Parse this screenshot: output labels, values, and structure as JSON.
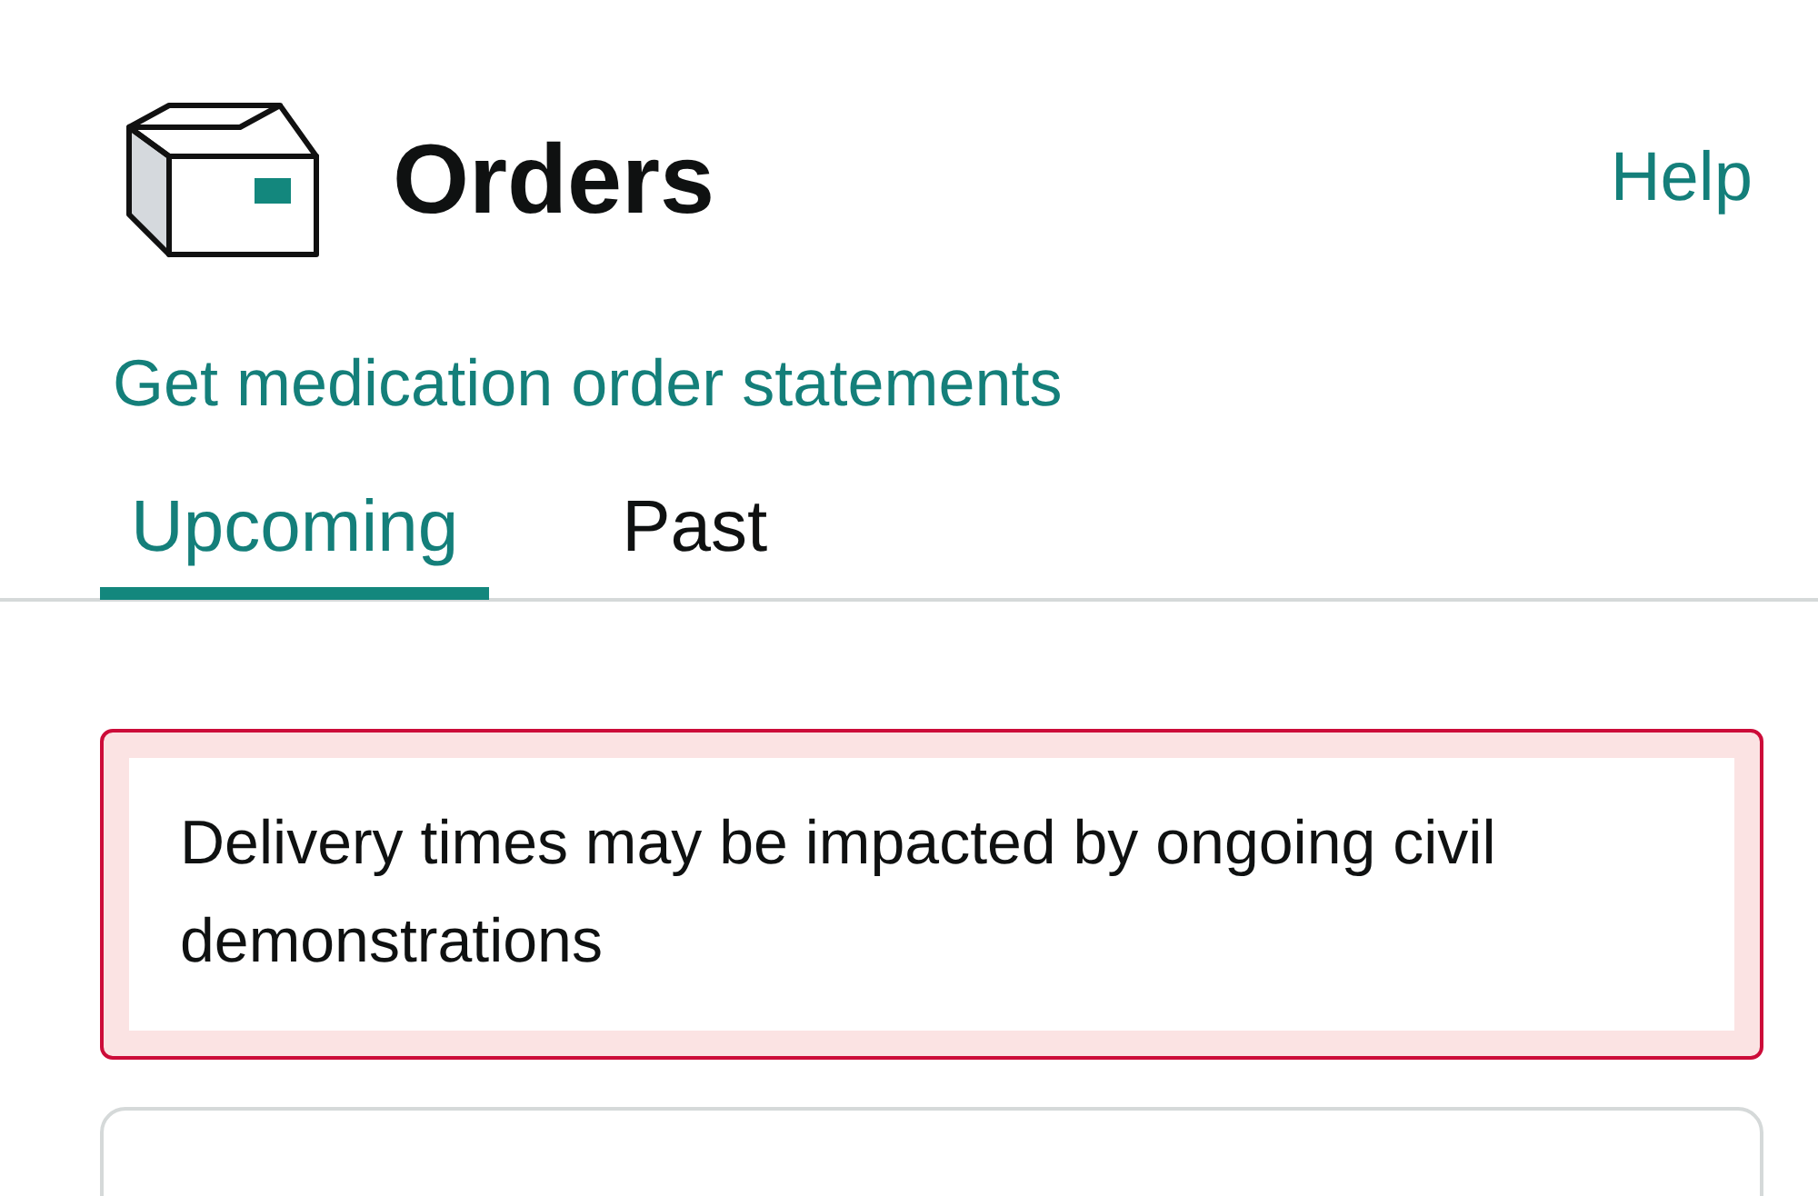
{
  "header": {
    "title": "Orders",
    "help_link": "Help"
  },
  "statements_link": "Get medication order statements",
  "tabs": [
    {
      "label": "Upcoming",
      "selected": true
    },
    {
      "label": "Past",
      "selected": false
    }
  ],
  "alert": {
    "message": "Delivery times may be impacted by ongoing civil demonstrations"
  }
}
